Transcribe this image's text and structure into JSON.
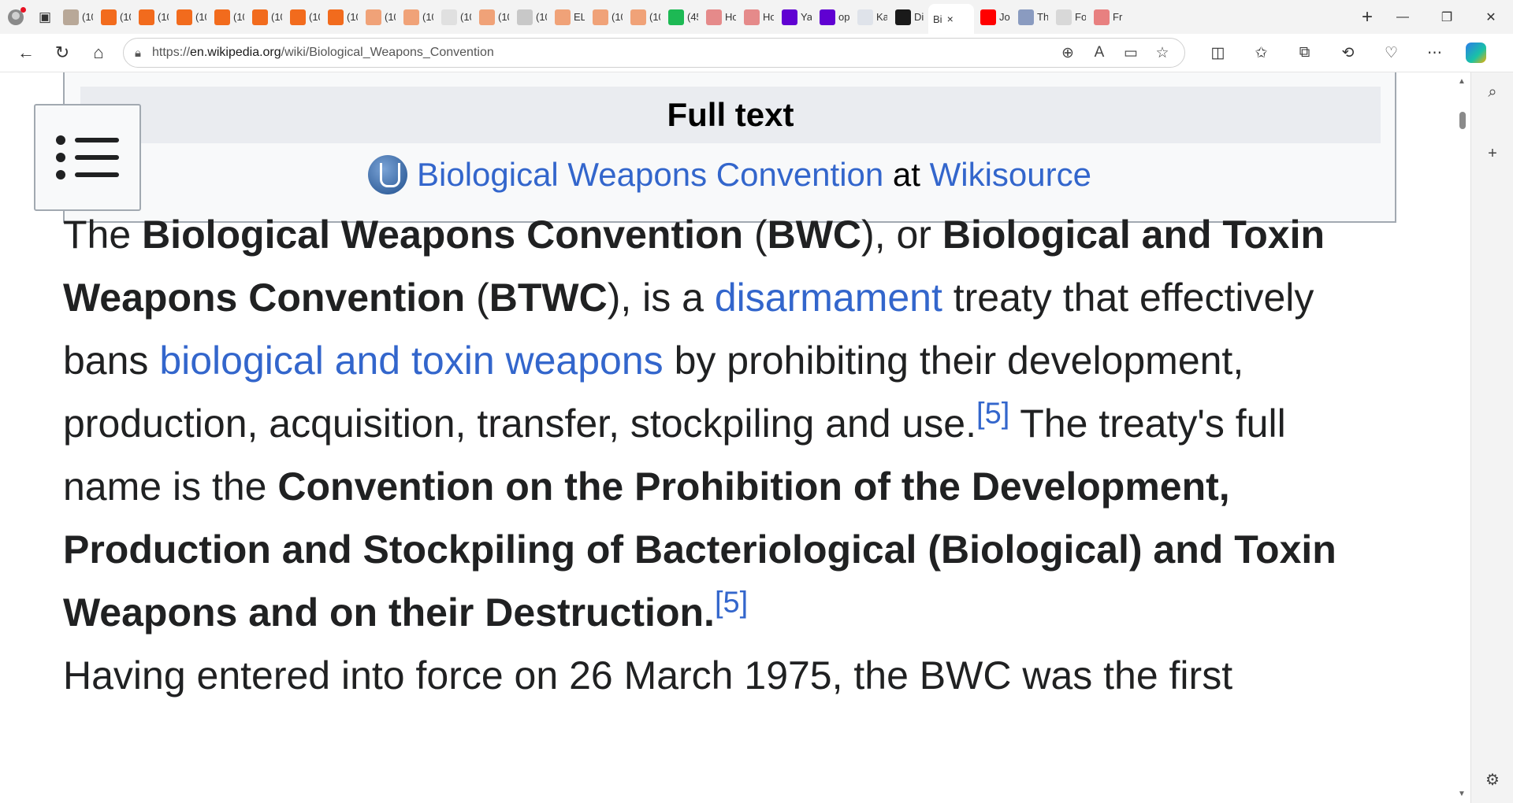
{
  "browser": {
    "tabs": [
      {
        "title": "(10",
        "color": "#b8a898"
      },
      {
        "title": "(10",
        "color": "#f26b1d"
      },
      {
        "title": "(10",
        "color": "#f26b1d"
      },
      {
        "title": "(10",
        "color": "#f26b1d"
      },
      {
        "title": "(10",
        "color": "#f26b1d"
      },
      {
        "title": "(10",
        "color": "#f26b1d"
      },
      {
        "title": "(10",
        "color": "#f26b1d"
      },
      {
        "title": "(10",
        "color": "#f26b1d"
      },
      {
        "title": "(10",
        "color": "#f0a278"
      },
      {
        "title": "(10",
        "color": "#f0a278"
      },
      {
        "title": "(10",
        "color": "#e0e0e0"
      },
      {
        "title": "(10",
        "color": "#f0a278"
      },
      {
        "title": "(10",
        "color": "#c8c8c8"
      },
      {
        "title": "EL",
        "color": "#f0a278"
      },
      {
        "title": "(10",
        "color": "#f0a278"
      },
      {
        "title": "(10",
        "color": "#f0a278"
      },
      {
        "title": "(45",
        "color": "#1db954"
      },
      {
        "title": "Ho",
        "color": "#e58a8a"
      },
      {
        "title": "Ho",
        "color": "#e58a8a"
      },
      {
        "title": "Ya",
        "color": "#6001d2"
      },
      {
        "title": "op",
        "color": "#6001d2"
      },
      {
        "title": "Ka",
        "color": "#dfe3ea"
      },
      {
        "title": "Di",
        "color": "#1a1a1a"
      }
    ],
    "active_tab": {
      "title": "Bi",
      "close": "×"
    },
    "tabs_after": [
      {
        "title": "Jo",
        "color": "#ff0000"
      },
      {
        "title": "Th",
        "color": "#8a9bc0"
      },
      {
        "title": "Fo",
        "color": "#d8d8d8"
      },
      {
        "title": "Fr",
        "color": "#e88080"
      }
    ],
    "url_prefix": "https://",
    "url_main": "en.wikipedia.org",
    "url_path": "/wiki/Biological_Weapons_Convention"
  },
  "fulltext": {
    "heading": "Full text",
    "link1": "Biological Weapons Convention",
    "at": "at",
    "link2": "Wikisource"
  },
  "p1": {
    "t1": "The ",
    "b1": "Biological Weapons Convention",
    "t2": " (",
    "b2": "BWC",
    "t3": "), or ",
    "b3": "Biological and Toxin Weapons Convention",
    "t4": " (",
    "b4": "BTWC",
    "t5": "), is a ",
    "l1": "disarmament",
    "t6": " treaty that effectively bans ",
    "l2": "biological and toxin weapons",
    "t7": " by prohibiting their development, production, acquisition, transfer, stockpiling and use.",
    "ref1": "[5]",
    "t8": " The treaty's full name is the ",
    "b5": "Convention on the Prohibition of the Development, Production and Stockpiling of Bacteriological (Biological) and Toxin Weapons and on their Destruction.",
    "ref2": "[5]"
  },
  "p2": {
    "text": "Having entered into force on 26 March 1975, the BWC was the first"
  }
}
